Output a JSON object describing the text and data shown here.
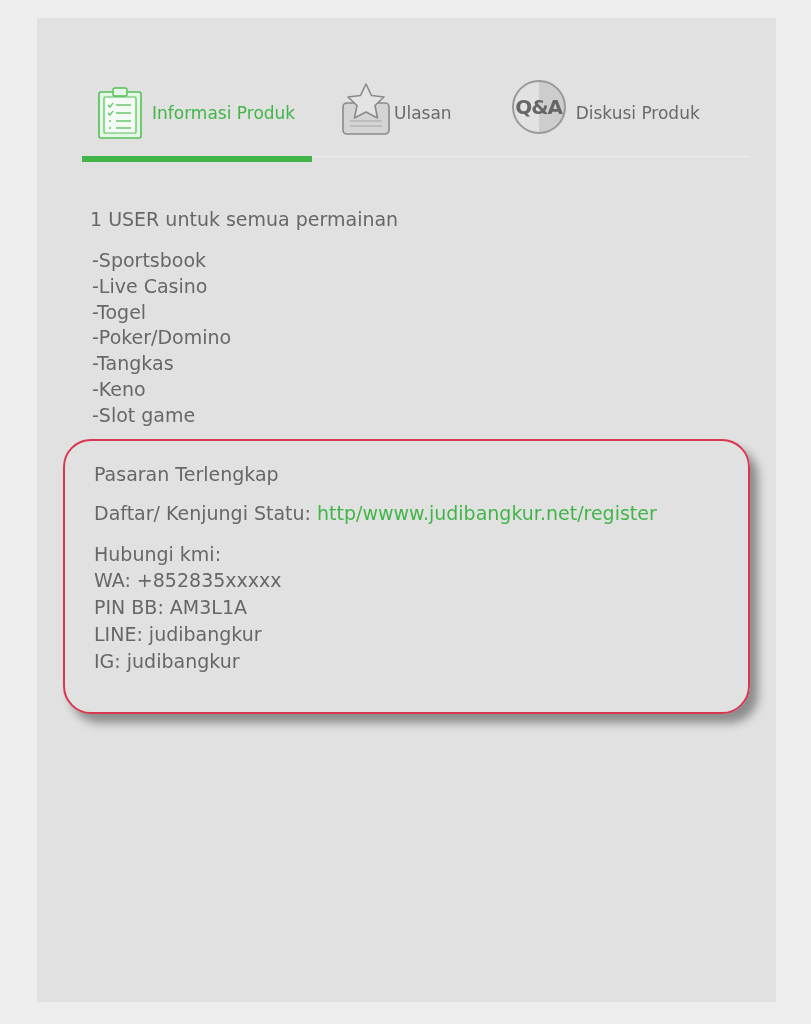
{
  "tabs": [
    {
      "label": "Informasi Produk",
      "selected": true,
      "kind": "info"
    },
    {
      "label": "Ulasan",
      "selected": false,
      "kind": "review"
    },
    {
      "label": "Diskusi Produk",
      "selected": false,
      "kind": "discussion",
      "icon_text": "Q&A"
    }
  ],
  "description": {
    "intro": "1 USER untuk semua permainan",
    "games": [
      "-Sportsbook",
      "-Live Casino",
      "-Togel",
      "-Poker/Domino",
      "-Tangkas",
      "-Keno",
      "-Slot game"
    ]
  },
  "highlight_box": {
    "heading": "Pasaran Terlengkap",
    "register_label": "Daftar/ Kenjungi Statu:",
    "register_link": "http/wwww.judibangkur.net/register",
    "contact_heading": "Hubungi kmi:",
    "contacts": [
      "WA: +852835xxxxx",
      "PIN BB: AM3L1A",
      "LINE: judibangkur",
      "IG: judibangkur"
    ]
  }
}
